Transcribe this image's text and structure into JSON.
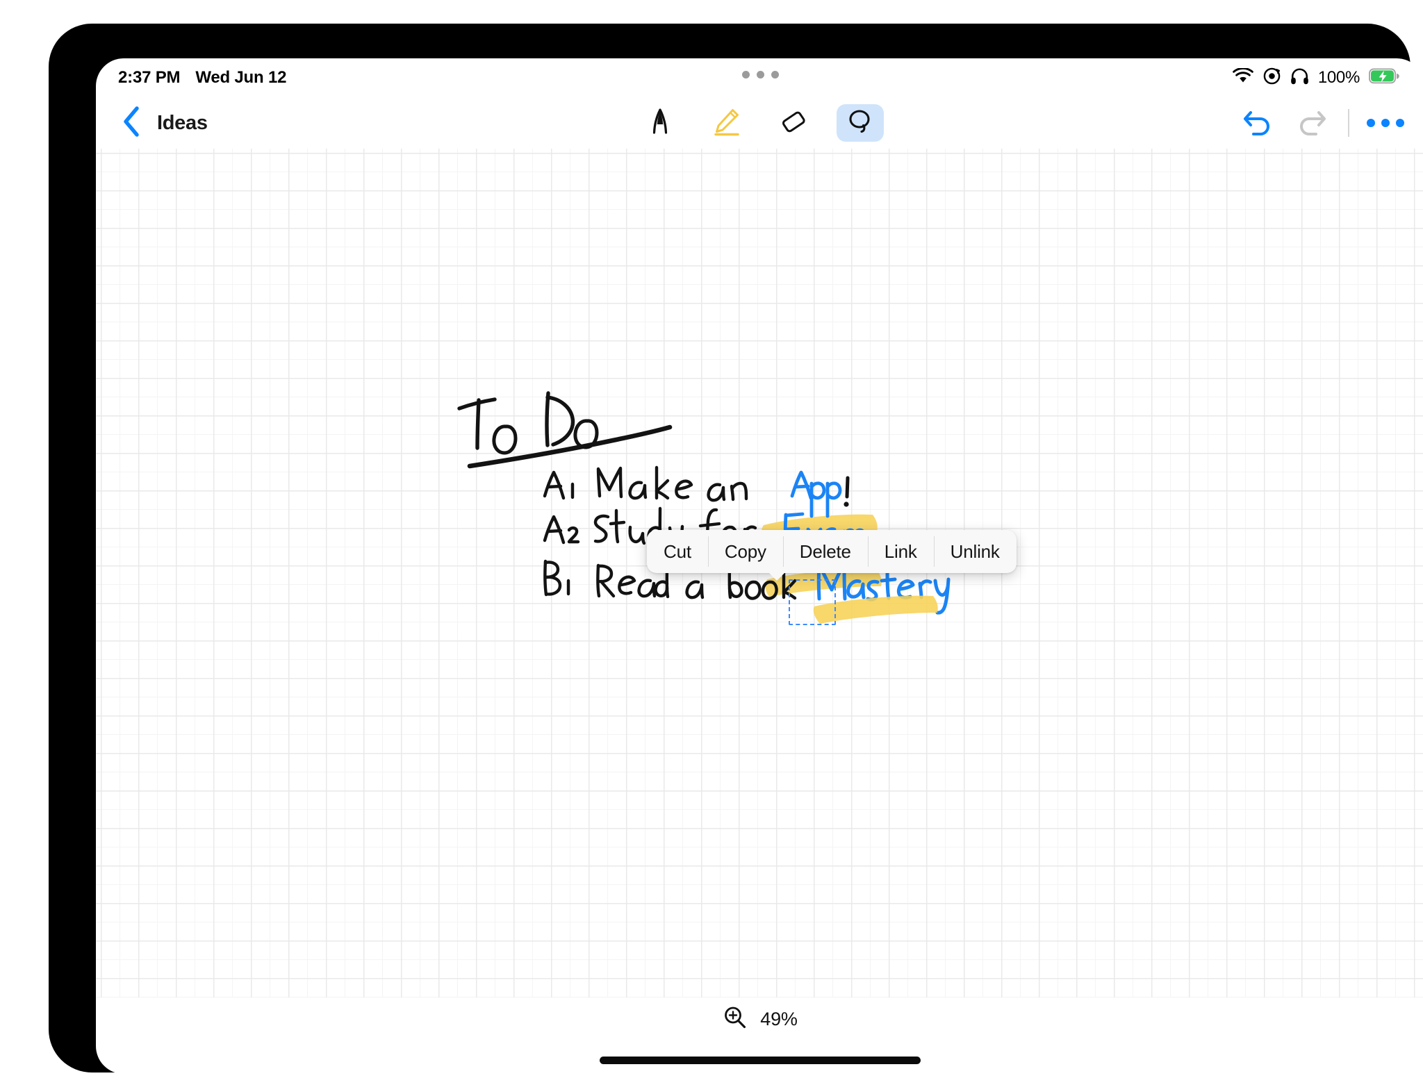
{
  "status_bar": {
    "time": "2:37 PM",
    "date": "Wed Jun 12",
    "battery_percent": "100%",
    "icons": [
      "wifi-icon",
      "rotation-lock-icon",
      "headphones-icon",
      "battery-charging-icon"
    ],
    "multitask_handle": "multitask-dots"
  },
  "nav_bar": {
    "back_label": "back-chevron-icon",
    "title": "Ideas",
    "tools": [
      {
        "name": "pen-tool",
        "icon": "pen-nib-icon",
        "active": false
      },
      {
        "name": "highlighter-tool",
        "icon": "highlighter-pencil-icon",
        "active": false,
        "color": "#F5C842"
      },
      {
        "name": "eraser-tool",
        "icon": "eraser-icon",
        "active": false
      },
      {
        "name": "lasso-tool",
        "icon": "lasso-icon",
        "active": true
      }
    ],
    "undo_label": "undo-arrow-icon",
    "redo_label": "redo-arrow-icon",
    "more_label": "more-options-icon"
  },
  "context_menu": {
    "items": [
      {
        "label": "Cut"
      },
      {
        "label": "Copy"
      },
      {
        "label": "Delete"
      },
      {
        "label": "Link"
      },
      {
        "label": "Unlink"
      }
    ]
  },
  "canvas": {
    "title_text": "To Do",
    "rows": [
      {
        "marker": "A1",
        "text": "Make an",
        "link": "App",
        "suffix": "!",
        "highlighted": true,
        "selected": true
      },
      {
        "marker": "A2",
        "text": "Study for",
        "link": "Exam",
        "suffix": "",
        "highlighted": true,
        "selected": false
      },
      {
        "marker": "B1",
        "text": "Read a book",
        "link": "Mastery",
        "suffix": "",
        "highlighted": true,
        "selected": false
      }
    ],
    "ink_color_black": "#111111",
    "ink_color_link": "#1b84f5",
    "highlighter_color": "#F7D257",
    "selection_color": "#3d8bfd"
  },
  "zoom_control": {
    "icon": "zoom-in-magnifier-icon",
    "level": "49%"
  }
}
